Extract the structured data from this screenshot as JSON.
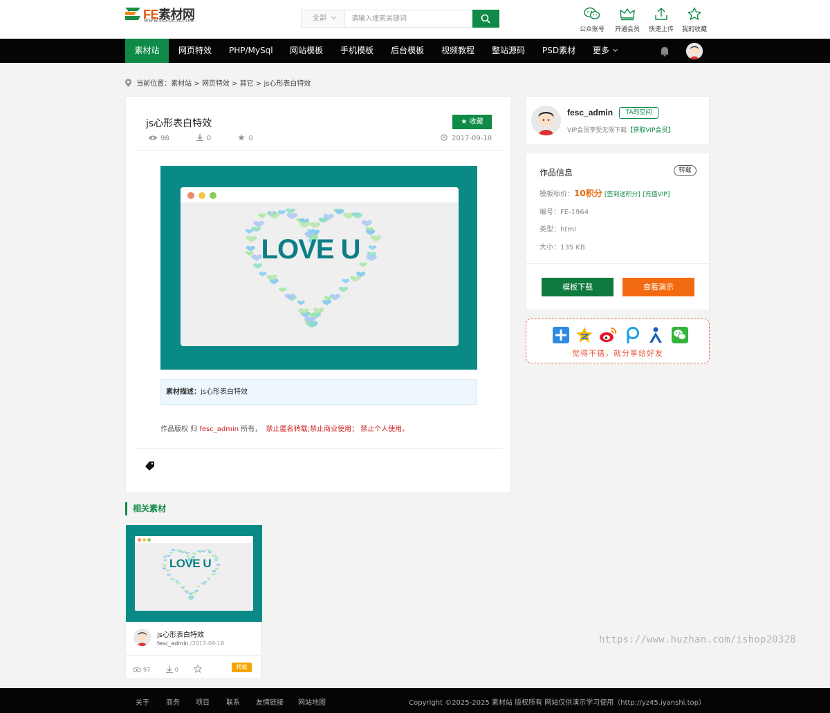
{
  "header": {
    "logo_text_fe": "FE",
    "logo_text_cn": "素材网",
    "logo_url_text": "WWW.FESUCAI.COM",
    "search_scope": "全部",
    "search_placeholder": "请输入搜索关键词",
    "quick_links": [
      {
        "label": "公众账号",
        "icon": "wechat-icon"
      },
      {
        "label": "开通会员",
        "icon": "crown-icon"
      },
      {
        "label": "快速上传",
        "icon": "upload-icon"
      },
      {
        "label": "我的收藏",
        "icon": "star-icon"
      }
    ]
  },
  "nav": {
    "items": [
      "素材站",
      "网页特效",
      "PHP/MySql",
      "网站模板",
      "手机模板",
      "后台模板",
      "视频教程",
      "整站源码",
      "PSD素材",
      "更多"
    ],
    "active_index": 0
  },
  "breadcrumb": {
    "prefix": "当前位置：",
    "parts": [
      "素材站",
      "网页特效",
      "其它",
      "js心形表白特效"
    ],
    "separator": " > "
  },
  "detail": {
    "title": "js心形表白特效",
    "views": "98",
    "downloads": "0",
    "favorites": "0",
    "fav_button": "收藏",
    "date": "2017-09-18",
    "preview_text": "LOVE U",
    "desc_label": "素材描述：",
    "desc_text": "js心形表白特效",
    "rights_prefix": "作品版权 归 ",
    "rights_owner": "fesc_admin",
    "rights_mid": " 所有，",
    "rights_rules": "禁止匿名转载;禁止商业使用；  禁止个人使用。"
  },
  "user": {
    "name": "fesc_admin",
    "space_button": "TA的空间",
    "vip_text": "VIP会员享受无限下载",
    "vip_link": "【获取VIP会员】"
  },
  "info": {
    "heading": "作品信息",
    "repost": "转载",
    "price_label": "模板标价：",
    "price": "10积分",
    "price_link1": "[签到送积分]",
    "price_link2": "[充值VIP]",
    "id_label": "编号：",
    "id": "FE-1964",
    "type_label": "类型：",
    "type": "html",
    "size_label": "大小：",
    "size": "135 KB",
    "download_button": "模板下载",
    "demo_button": "查看演示"
  },
  "share": {
    "slogan": "觉得不错，就分享给好友",
    "icons": [
      "plus-share-icon",
      "qzone-icon",
      "weibo-icon",
      "pengyou-icon",
      "renren-icon",
      "wechat-share-icon"
    ]
  },
  "related": {
    "heading": "相关素材",
    "items": [
      {
        "title": "js心形表白特效",
        "author": "fesc_admin",
        "date": "/2017-09-18",
        "views": "97",
        "downloads": "0",
        "badge": "转载",
        "preview_text": "LOVE U"
      }
    ]
  },
  "watermark": "https://www.huzhan.com/ishop20328",
  "footer": {
    "links": [
      "关于",
      "商务",
      "项目",
      "联系",
      "友情链接",
      "网站地图"
    ],
    "copyright": "Copyright ©2025-2025 素材站 版权所有 网站仅供演示学习使用（http://yz45.iyanshi.top）"
  },
  "colors": {
    "brand_green": "#0f8a47",
    "orange": "#f26a0f",
    "teal_preview": "#0a8a86",
    "nav_black": "#050505"
  }
}
